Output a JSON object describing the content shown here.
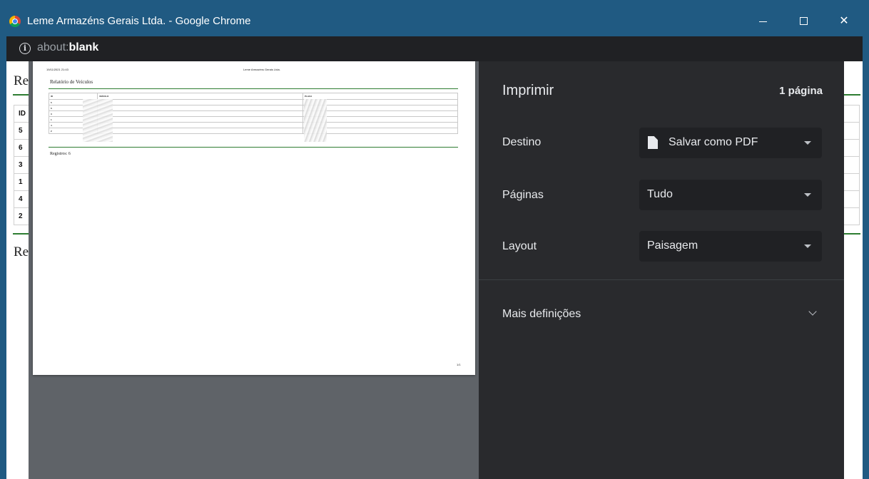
{
  "window": {
    "title": "Leme Armazéns Gerais Ltda. - Google Chrome",
    "url_scheme": "about:",
    "url_host": "blank"
  },
  "background_page": {
    "title_fragment": "Re",
    "footer_fragment": "Re",
    "table_header_id": "ID",
    "row_ids": [
      "5",
      "6",
      "3",
      "1",
      "4",
      "2"
    ]
  },
  "preview": {
    "datetime": "19/11/2021 21:43",
    "company": "Leme Armazéns Gerais Ltda.",
    "report_title": "Relatório de Veículos",
    "columns": [
      "ID",
      "VEÍCULO",
      "PLACA"
    ],
    "row_ids": [
      "5",
      "6",
      "3",
      "1",
      "4",
      "2"
    ],
    "records_label": "Registros: 6",
    "page_number": "1/1"
  },
  "print_panel": {
    "title": "Imprimir",
    "page_count": "1 página",
    "destination_label": "Destino",
    "destination_value": "Salvar como PDF",
    "pages_label": "Páginas",
    "pages_value": "Tudo",
    "layout_label": "Layout",
    "layout_value": "Paisagem",
    "more_settings": "Mais definições"
  },
  "icons": {
    "app": "chrome-logo-icon",
    "info": "info-icon",
    "file": "file-icon",
    "dropdown": "caret-down-icon",
    "expand": "chevron-down-icon"
  },
  "colors": {
    "titlebar": "#205a82",
    "addressbar": "#202124",
    "panel": "#292a2d",
    "preview_bg": "#5f6368",
    "accent_rule": "#2e7d32"
  }
}
